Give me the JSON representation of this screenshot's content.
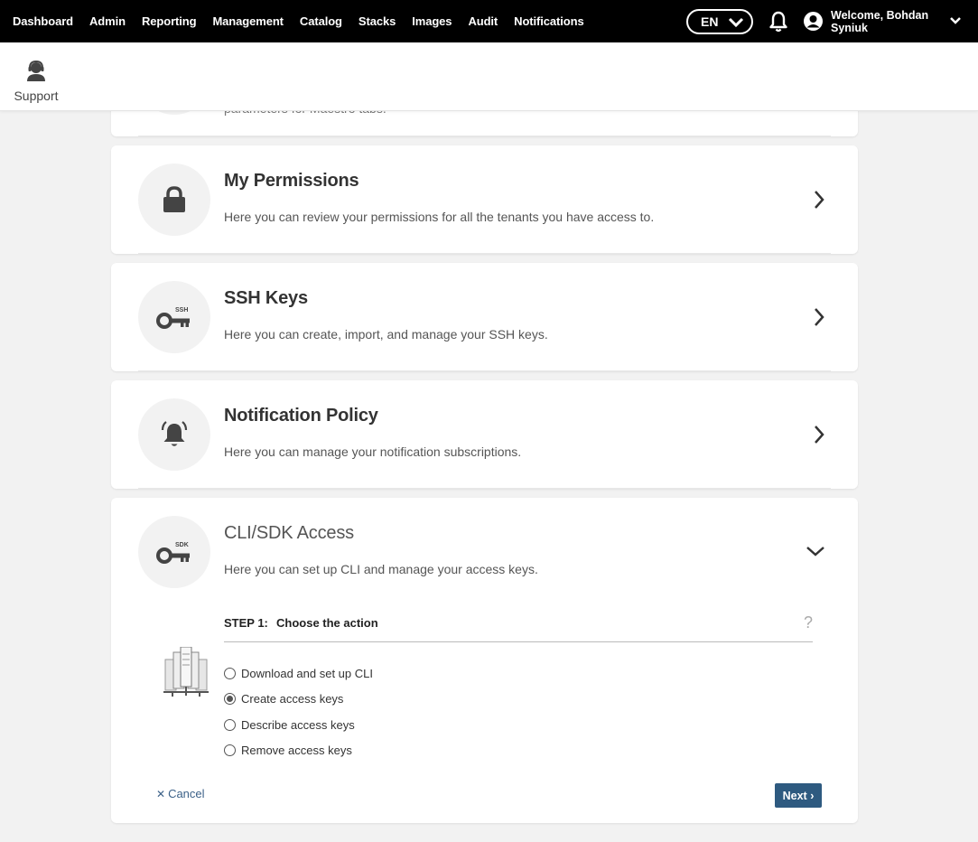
{
  "nav": {
    "items": [
      "Dashboard",
      "Admin",
      "Reporting",
      "Management",
      "Catalog",
      "Stacks",
      "Images",
      "Audit",
      "Notifications"
    ],
    "language": "EN",
    "welcome": "Welcome, Bohdan Syniuk"
  },
  "support": {
    "label": "Support"
  },
  "partial_card": {
    "text": "parameters for Maestro tabs."
  },
  "cards": [
    {
      "title": "My Permissions",
      "desc": "Here you can review your permissions for all the tenants you have access to.",
      "icon": "lock-icon"
    },
    {
      "title": "SSH Keys",
      "desc": "Here you can create, import, and manage your SSH keys.",
      "icon": "ssh-key-icon",
      "badge": "SSH"
    },
    {
      "title": "Notification Policy",
      "desc": "Here you can manage your notification subscriptions.",
      "icon": "alarm-bell-icon"
    }
  ],
  "cli": {
    "title": "CLI/SDK Access",
    "desc": "Here you can set up CLI and manage your access keys.",
    "badge": "SDK",
    "step_num": "STEP 1:",
    "step_text": "Choose the action",
    "help": "?",
    "options": [
      {
        "label": "Download and set up CLI",
        "selected": false
      },
      {
        "label": "Create access keys",
        "selected": true
      },
      {
        "label": "Describe access keys",
        "selected": false
      },
      {
        "label": "Remove access keys",
        "selected": false
      }
    ],
    "cancel": "Cancel",
    "next": "Next ›"
  },
  "colors": {
    "accent": "#2e5a80",
    "link": "#3c6188",
    "topbar": "#000000"
  }
}
